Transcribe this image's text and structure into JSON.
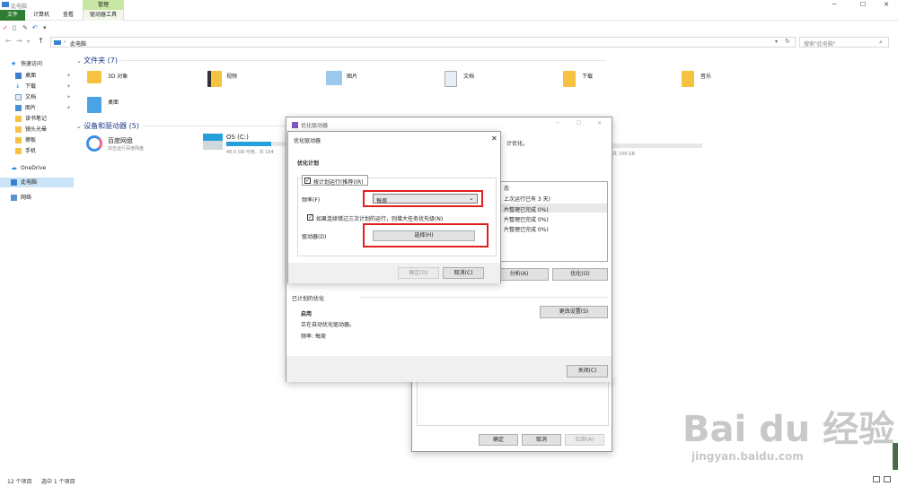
{
  "window": {
    "title": "此电脑",
    "manage_tab": "管理",
    "tabs": [
      "文件",
      "计算机",
      "查看",
      "驱动器工具"
    ],
    "minimize": "─",
    "maximize": "☐",
    "close": "✕"
  },
  "address": {
    "path": "此电脑",
    "search_placeholder": "搜索\"此电脑\"",
    "sep": "›"
  },
  "nav": {
    "quick_access": "快速访问",
    "items": [
      "桌面",
      "下载",
      "文档",
      "图片",
      "读书笔记",
      "镜头光晕",
      "擦板",
      "手机"
    ],
    "onedrive": "OneDrive",
    "this_pc": "此电脑",
    "network": "网络"
  },
  "folders": {
    "header": "文件夹 (7)",
    "items": [
      "3D 对象",
      "视频",
      "图片",
      "文档",
      "下载",
      "音乐",
      "桌面"
    ]
  },
  "devices": {
    "header": "设备和驱动器 (5)",
    "baidu": {
      "name": "百度网盘",
      "sub": "双击运行百度网盘"
    },
    "os": {
      "name": "OS (C:)",
      "sub": "48.0 GB 可用，共 104",
      "used": 0.54
    },
    "other_sub": "共 199 GB"
  },
  "status": {
    "count": "12 个项目",
    "selected": "选中 1 个项目"
  },
  "optimize_bg": {
    "title": "优化驱动器",
    "desc_partial": "计优化。",
    "list_header": "态",
    "rows": [
      "上次运行已有 3 天)",
      "片整理已完成 0%)",
      "片整理已完成 0%)",
      "片整理已完成 0%)"
    ],
    "analyze": "分析(A)",
    "optimize": "优化(O)",
    "scheduled_header": "已计划的优化",
    "enabled": "启用",
    "auto_text": "正在自动优化驱动器。",
    "freq": "频率: 每周",
    "change": "更改设置(S)",
    "close": "关闭(C)"
  },
  "props_bg": {
    "ok": "确定",
    "cancel": "取消",
    "apply": "应用(A)"
  },
  "schedule_dlg": {
    "title": "优化驱动器",
    "heading": "优化计划",
    "run_on_schedule": "按计划运行(推荐)(R)",
    "freq_label": "频率(F)",
    "freq_value": "每周",
    "missed_label": "如果连续错过三次计划的运行，则增大任务优先级(N)",
    "drives_label": "驱动器(D)",
    "choose": "选择(H)",
    "ok": "确定(O)",
    "cancel": "取消(C)"
  },
  "watermark": {
    "brand": "Bai du 经验",
    "url": "jingyan.baidu.com"
  }
}
